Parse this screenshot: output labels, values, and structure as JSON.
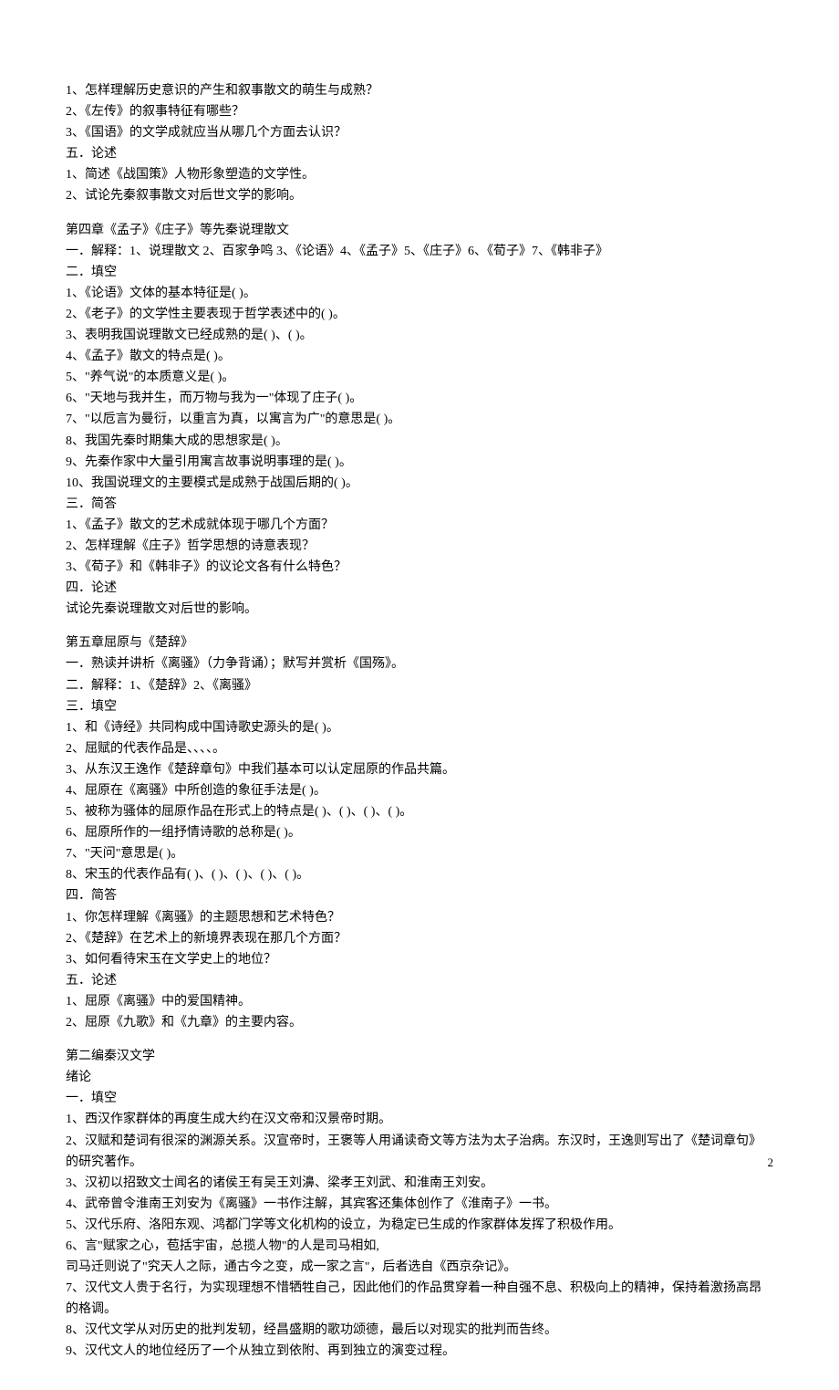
{
  "sec1": {
    "q1": "1、怎样理解历史意识的产生和叙事散文的萌生与成熟？",
    "q2": "2、《左传》的叙事特征有哪些？",
    "q3": "3、《国语》的文学成就应当从哪几个方面去认识？",
    "h5": "五．论述",
    "q5_1": "1、简述《战国策》人物形象塑造的文学性。",
    "q5_2": "2、试论先秦叙事散文对后世文学的影响。"
  },
  "ch4": {
    "title": "第四章《孟子》《庄子》等先秦说理散文",
    "h1": "一．解释：1、说理散文 2、百家争鸣 3、《论语》4、《孟子》5、《庄子》6、《荀子》7、《韩非子》",
    "h2": "二．填空",
    "f1": "1、《论语》文体的基本特征是(                )。",
    "f2": "2、《老子》的文学性主要表现于哲学表述中的(               )。",
    "f3": "3、表明我国说理散文已经成熟的是(               )、(               )。",
    "f4": "4、《孟子》散文的特点是(                           )。",
    "f5": "5、\"养气说\"的本质意义是(                                          )。",
    "f6": "6、\"天地与我并生，而万物与我为一\"体现了庄子(                              )。",
    "f7": "7、\"以卮言为曼衍，以重言为真，以寓言为广\"的意思是(                              )。",
    "f8": "8、我国先秦时期集大成的思想家是(               )。",
    "f9": "9、先秦作家中大量引用寓言故事说明事理的是(               )。",
    "f10": "10、我国说理文的主要模式是成熟于战国后期的(               )。",
    "h3": "三．简答",
    "s1": "1、《孟子》散文的艺术成就体现于哪几个方面？",
    "s2": "2、怎样理解《庄子》哲学思想的诗意表现？",
    "s3": "3、《荀子》和《韩非子》的议论文各有什么特色？",
    "h4": "四．论述",
    "d1": "试论先秦说理散文对后世的影响。"
  },
  "ch5": {
    "title": "第五章屈原与《楚辞》",
    "h1": "一．熟读并讲析《离骚》（力争背诵）；默写并赏析《国殇》。",
    "h2": "二．解释：1、《楚辞》2、《离骚》",
    "h3": "三．填空",
    "f1": "1、和《诗经》共同构成中国诗歌史源头的是(               )。",
    "f2": "2、屈赋的代表作品是、、、、。",
    "f3": "3、从东汉王逸作《楚辞章句》中我们基本可以认定屈原的作品共篇。",
    "f4": "4、屈原在《离骚》中所创造的象征手法是(                                  )。",
    "f5": "5、被称为骚体的屈原作品在形式上的特点是(               )、(               )、(               )、(               )。",
    "f6": "6、屈原所作的一组抒情诗歌的总称是(               )。",
    "f7": "7、\"天问\"意思是(                              )。",
    "f8": "8、宋玉的代表作品有(               )、(               )、(               )、(               )、(               )。",
    "h4": "四．简答",
    "s1": "1、你怎样理解《离骚》的主题思想和艺术特色？",
    "s2": "2、《楚辞》在艺术上的新境界表现在那几个方面？",
    "s3": "3、如何看待宋玉在文学史上的地位？",
    "h5": "五．论述",
    "d1": "1、屈原《离骚》中的爱国精神。",
    "d2": "2、屈原《九歌》和《九章》的主要内容。"
  },
  "part2": {
    "title": "第二编秦汉文学",
    "sub": "绪论",
    "h1": "一．填空",
    "f1": "1、西汉作家群体的再度生成大约在汉文帝和汉景帝时期。",
    "f2": "2、汉赋和楚词有很深的渊源关系。汉宣帝时，王褒等人用诵读奇文等方法为太子治病。东汉时，王逸则写出了《楚词章句》的研究著作。",
    "f3": "3、汉初以招致文士闻名的诸侯王有吴王刘濞、梁孝王刘武、和淮南王刘安。",
    "f4": "4、武帝曾令淮南王刘安为《离骚》一书作注解，其宾客还集体创作了《淮南子》一书。",
    "f5": "5、汉代乐府、洛阳东观、鸿都门学等文化机构的设立，为稳定已生成的作家群体发挥了积极作用。",
    "f6": "6、言\"赋家之心，苞括宇宙，总揽人物\"的人是司马相如,",
    "f6b": "司马迁则说了\"究天人之际，通古今之变，成一家之言\"，后者选自《西京杂记》。",
    "f7": "7、汉代文人贵于名行，为实现理想不惜牺牲自己，因此他们的作品贯穿着一种自强不息、积极向上的精神，保持着激扬高昂的格调。",
    "f8": "8、汉代文学从对历史的批判发轫，经昌盛期的歌功颂德，最后以对现实的批判而告终。",
    "f9": "9、汉代文人的地位经历了一个从独立到依附、再到独立的演变过程。"
  },
  "pagenum": "2"
}
